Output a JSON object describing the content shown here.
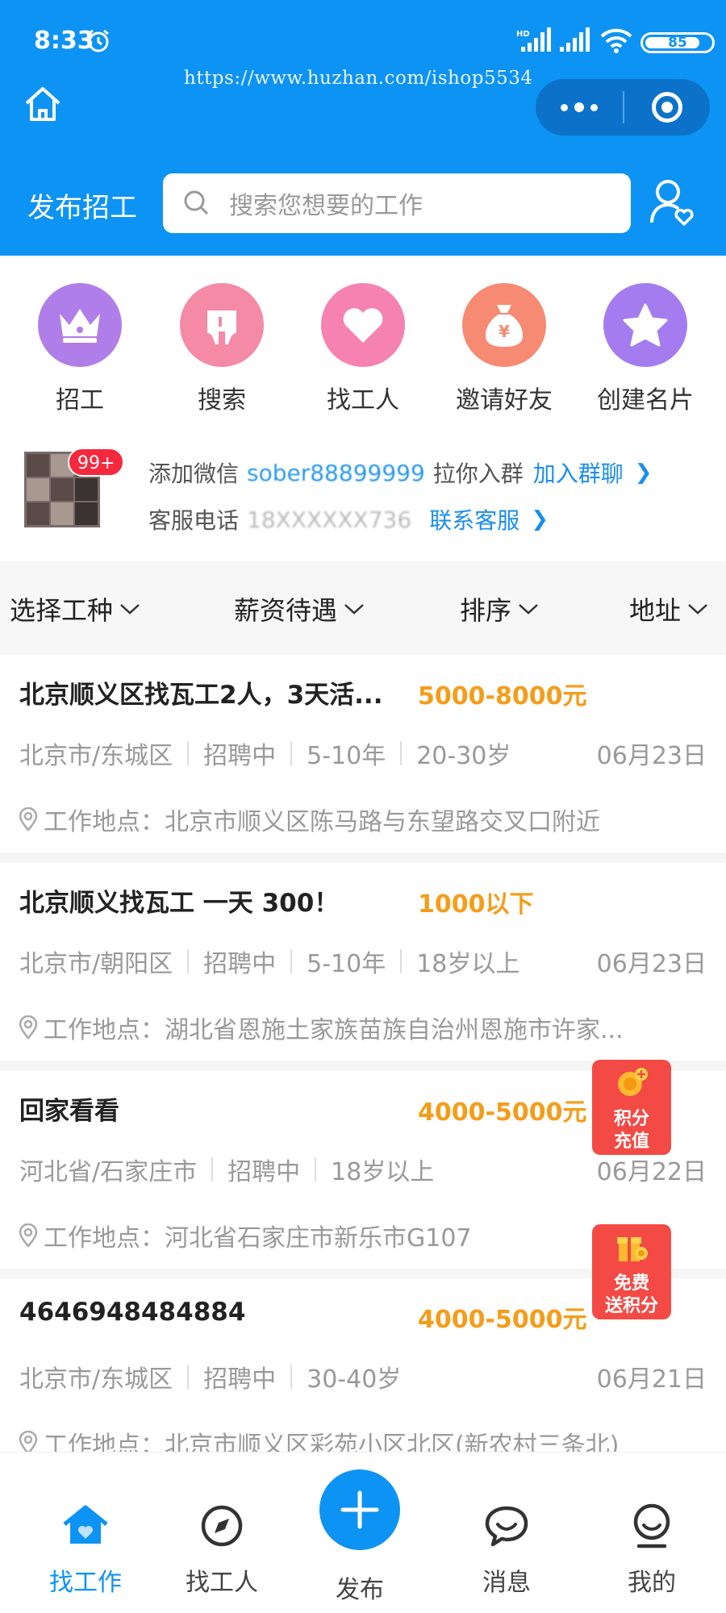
{
  "status_bar": {
    "time": "8:33",
    "battery": "85",
    "battery_level": 0.85
  },
  "url_watermark": "https://www.huzhan.com/ishop5534",
  "header": {
    "post_job_label": "发布招工",
    "search_placeholder": "搜索您想要的工作"
  },
  "quick_nav": [
    {
      "label": "招工",
      "icon": "crown-icon",
      "color": "#b07ee8"
    },
    {
      "label": "搜索",
      "icon": "search-tooth-icon",
      "color": "#f48aa6"
    },
    {
      "label": "找工人",
      "icon": "heart-icon",
      "color": "#f582b0"
    },
    {
      "label": "邀请好友",
      "icon": "money-bag-icon",
      "color": "#f78a72"
    },
    {
      "label": "创建名片",
      "icon": "star-icon",
      "color": "#a57cf0"
    }
  ],
  "group": {
    "badge": "99+",
    "line1_prefix": "添加微信",
    "wechat": "sober88899999",
    "line1_suffix": "拉你入群",
    "join_link": "加入群聊",
    "line2_prefix": "客服电话",
    "phone": "18XXXXXX736",
    "contact_link": "联系客服"
  },
  "filters": [
    "选择工种",
    "薪资待遇",
    "排序",
    "地址"
  ],
  "jobs": [
    {
      "title": "北京顺义区找瓦工2人，3天活...",
      "salary": "5000-8000元",
      "meta": [
        "北京市/东城区",
        "招聘中",
        "5-10年",
        "20-30岁"
      ],
      "date": "06月23日",
      "location_label": "工作地点：",
      "location": "北京市顺义区陈马路与东望路交叉口附近"
    },
    {
      "title": "北京顺义找瓦工 一天 300！",
      "salary": "1000以下",
      "meta": [
        "北京市/朝阳区",
        "招聘中",
        "5-10年",
        "18岁以上"
      ],
      "date": "06月23日",
      "location_label": "工作地点：",
      "location": "湖北省恩施土家族苗族自治州恩施市许家..."
    },
    {
      "title": "回家看看",
      "salary": "4000-5000元",
      "meta": [
        "河北省/石家庄市",
        "招聘中",
        "18岁以上"
      ],
      "date": "06月22日",
      "location_label": "工作地点：",
      "location": "河北省石家庄市新乐市G107"
    },
    {
      "title": "4646948484884",
      "salary": "4000-5000元",
      "meta": [
        "北京市/东城区",
        "招聘中",
        "30-40岁"
      ],
      "date": "06月21日",
      "location_label": "工作地点：",
      "location": "北京市顺义区彩苑小区北区(新农村三条北)"
    }
  ],
  "floating": {
    "recharge": [
      "积分",
      "充值"
    ],
    "free": [
      "免费",
      "送积分"
    ]
  },
  "tabbar": {
    "items": [
      "找工作",
      "找工人",
      "发布",
      "消息",
      "我的"
    ],
    "active": "找工作"
  },
  "colors": {
    "primary": "#0d93f3",
    "salary": "#f59c1a",
    "badge": "#f5283e"
  }
}
